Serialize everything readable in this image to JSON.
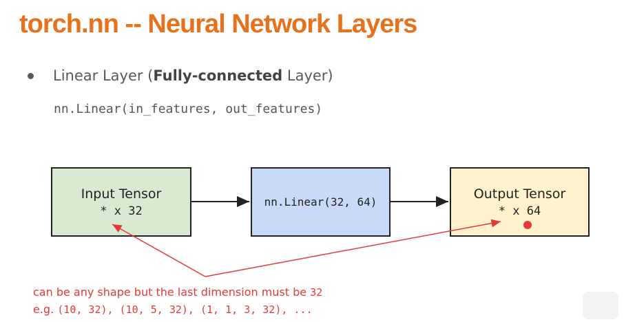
{
  "slide": {
    "title": "torch.nn -- Neural Network Layers",
    "bullet": {
      "prefix": "Linear Layer (",
      "bold": "Fully-connected",
      "suffix": " Layer)"
    },
    "code": "nn.Linear(in_features, out_features)"
  },
  "diagram": {
    "input": {
      "label": "Input Tensor",
      "shape": "* x 32"
    },
    "layer": {
      "label": "nn.Linear(32, 64)"
    },
    "output": {
      "label": "Output Tensor",
      "shape": "* x 64"
    }
  },
  "annotation": {
    "line1_text": "can be any shape but the last dimension must be ",
    "line1_num": "32",
    "line2_prefix": "e.g. ",
    "line2_examples": "(10, 32), (10, 5, 32), (1, 1, 3, 32), ...",
    "color": "#e53935"
  },
  "colors": {
    "title": "#e8711b",
    "input_fill": "#d9ead3",
    "layer_fill": "#c9daf8",
    "output_fill": "#fff2cc"
  }
}
